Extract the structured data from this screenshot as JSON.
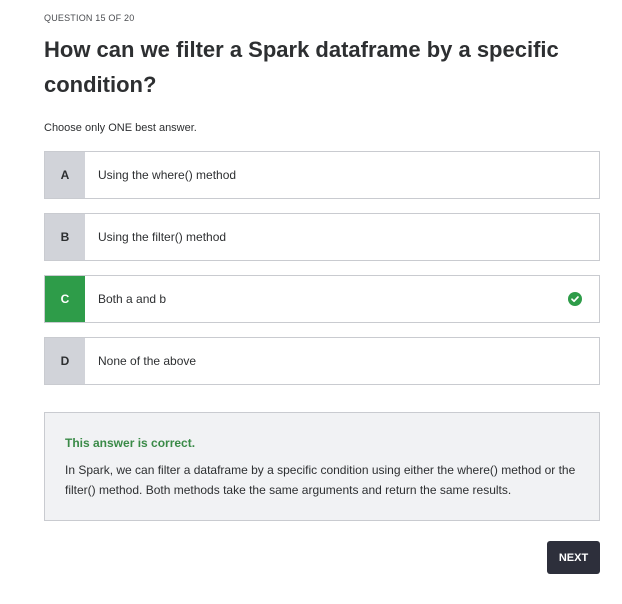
{
  "quiz": {
    "counter": "QUESTION 15 OF 20",
    "question": "How can we filter a Spark dataframe by a specific condition?",
    "instruction": "Choose only ONE best answer.",
    "options": [
      {
        "letter": "A",
        "text": "Using the where() method",
        "selected": false
      },
      {
        "letter": "B",
        "text": "Using the filter() method",
        "selected": false
      },
      {
        "letter": "C",
        "text": "Both a and b",
        "selected": true
      },
      {
        "letter": "D",
        "text": "None of the above",
        "selected": false
      }
    ],
    "selected_icon": "check-circle-icon",
    "feedback": {
      "title": "This answer is correct.",
      "text": "In Spark, we can filter a dataframe by a specific condition using either the where() method or the filter() method. Both methods take the same arguments and return the same results."
    },
    "next_label": "NEXT"
  },
  "colors": {
    "correct": "#2e9c49",
    "correct_text": "#3a8a47",
    "letter_bg": "#d1d3d9",
    "button_bg": "#2d2f3b"
  }
}
